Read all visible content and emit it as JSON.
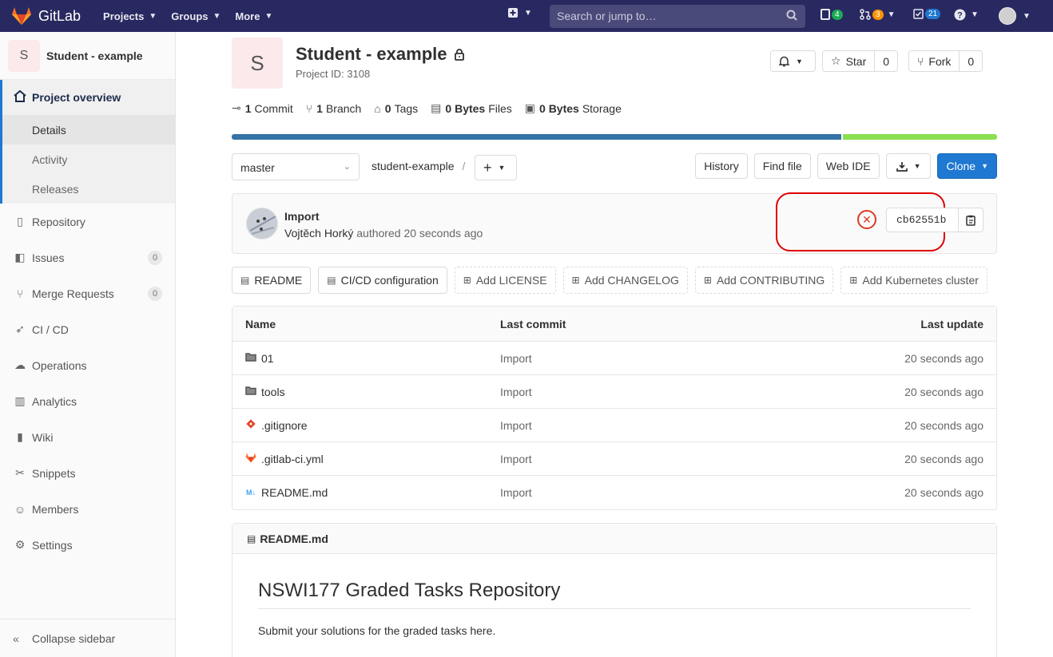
{
  "topbar": {
    "brand": "GitLab",
    "menus": [
      "Projects",
      "Groups",
      "More"
    ],
    "search_placeholder": "Search or jump to…",
    "issues_count": "4",
    "mr_count": "3",
    "todos_count": "21"
  },
  "sidebar": {
    "project_initial": "S",
    "project_name": "Student - example",
    "overview_label": "Project overview",
    "overview_sub": [
      "Details",
      "Activity",
      "Releases"
    ],
    "items": [
      {
        "label": "Repository"
      },
      {
        "label": "Issues",
        "count": "0"
      },
      {
        "label": "Merge Requests",
        "count": "0"
      },
      {
        "label": "CI / CD"
      },
      {
        "label": "Operations"
      },
      {
        "label": "Analytics"
      },
      {
        "label": "Wiki"
      },
      {
        "label": "Snippets"
      },
      {
        "label": "Members"
      },
      {
        "label": "Settings"
      }
    ],
    "collapse_label": "Collapse sidebar"
  },
  "project": {
    "initial": "S",
    "title": "Student - example",
    "id_text": "Project ID: 3108",
    "star_label": "Star",
    "star_count": "0",
    "fork_label": "Fork",
    "fork_count": "0"
  },
  "stats": {
    "commits_num": "1",
    "commits_label": "Commit",
    "branches_num": "1",
    "branches_label": "Branch",
    "tags_num": "0",
    "tags_label": "Tags",
    "files_num": "0 Bytes",
    "files_label": "Files",
    "storage_num": "0 Bytes",
    "storage_label": "Storage"
  },
  "toolbar": {
    "branch": "master",
    "path": "student-example",
    "path_sep": "/",
    "history": "History",
    "find_file": "Find file",
    "web_ide": "Web IDE",
    "clone": "Clone"
  },
  "commit": {
    "title": "Import",
    "author": "Vojtěch Horký",
    "verb": "authored",
    "time": "20 seconds ago",
    "sha": "cb62551b"
  },
  "quick_buttons": [
    {
      "label": "README",
      "dashed": false
    },
    {
      "label": "CI/CD configuration",
      "dashed": false
    },
    {
      "label": "Add LICENSE",
      "dashed": true
    },
    {
      "label": "Add CHANGELOG",
      "dashed": true
    },
    {
      "label": "Add CONTRIBUTING",
      "dashed": true
    },
    {
      "label": "Add Kubernetes cluster",
      "dashed": true
    }
  ],
  "files": {
    "headers": {
      "name": "Name",
      "commit": "Last commit",
      "update": "Last update"
    },
    "rows": [
      {
        "name": "01",
        "commit": "Import",
        "update": "20 seconds ago"
      },
      {
        "name": "tools",
        "commit": "Import",
        "update": "20 seconds ago"
      },
      {
        "name": ".gitignore",
        "commit": "Import",
        "update": "20 seconds ago"
      },
      {
        "name": ".gitlab-ci.yml",
        "commit": "Import",
        "update": "20 seconds ago"
      },
      {
        "name": "README.md",
        "commit": "Import",
        "update": "20 seconds ago"
      }
    ]
  },
  "readme": {
    "filename": "README.md",
    "heading": "NSWI177 Graded Tasks Repository",
    "paragraph": "Submit your solutions for the graded tasks here."
  },
  "colors": {
    "navbar": "#292961",
    "accent": "#1f78d1",
    "fail": "#db3b21",
    "lang_python": "#3572a5",
    "lang_shell": "#89e051",
    "annotation": "#e00000"
  }
}
